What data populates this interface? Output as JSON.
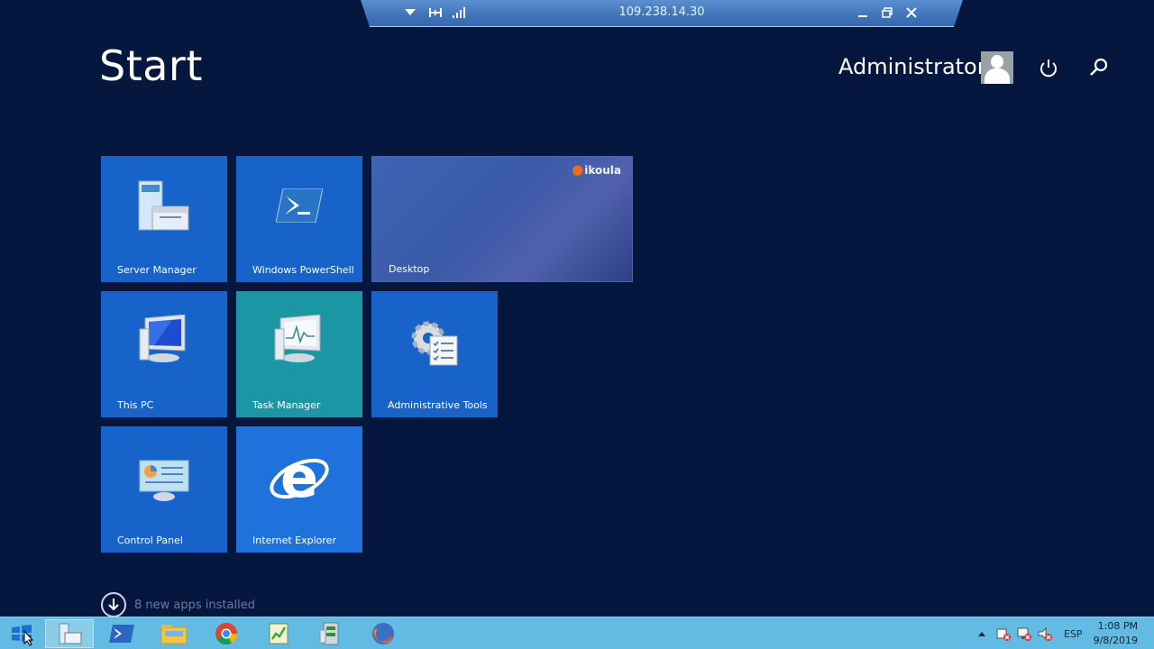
{
  "rdp": {
    "title": "109.238.14.30"
  },
  "header": {
    "title": "Start",
    "user": "Administrator"
  },
  "tiles": [
    {
      "label": "Server Manager",
      "icon": "server-manager-icon"
    },
    {
      "label": "Windows PowerShell",
      "icon": "powershell-icon"
    },
    {
      "label": "Desktop",
      "brand": "ikoula"
    },
    {
      "label": "This PC",
      "icon": "computer-icon"
    },
    {
      "label": "Task Manager",
      "icon": "task-manager-icon"
    },
    {
      "label": "Administrative Tools",
      "icon": "admin-tools-icon"
    },
    {
      "label": "Control Panel",
      "icon": "control-panel-icon"
    },
    {
      "label": "Internet Explorer",
      "icon": "internet-explorer-icon"
    }
  ],
  "apps_installed": "8 new apps installed",
  "taskbar": {
    "apps": [
      "server-manager",
      "powershell",
      "file-explorer",
      "chrome",
      "task-scheduler",
      "cpu-monitor",
      "firefox"
    ],
    "language": "ESP",
    "time": "1:08 PM",
    "date": "9/8/2019"
  },
  "colors": {
    "background": "#06173f",
    "tile_blue": "#1763c9",
    "tile_teal": "#1a96a4",
    "taskbar": "#62bbe3"
  }
}
